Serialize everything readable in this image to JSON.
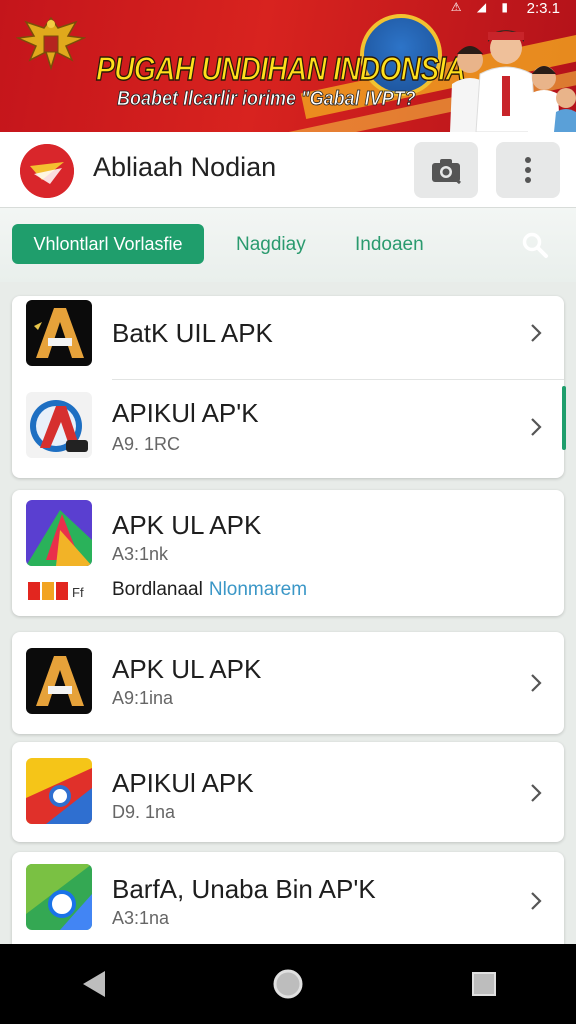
{
  "status_bar": {
    "time": "2:3.1",
    "icons": "⚠ ◢ ▮"
  },
  "banner": {
    "title": "PUGAH UNDIHAN INDONSIA",
    "subtitle": "Boabet Ilcarlir iorime \"Gabal IVPT?"
  },
  "header": {
    "title": "Abliaah Nodian",
    "camera_icon": "camera-icon",
    "more_icon": "more-vert-icon"
  },
  "tabs": [
    {
      "label": "Vhlontlarl Vorlasfie",
      "active": true
    },
    {
      "label": "Nagdiay",
      "active": false
    },
    {
      "label": "Indoaen",
      "active": false
    }
  ],
  "cards": [
    {
      "rows": [
        {
          "title": "BatK UIL APK",
          "sub": ""
        },
        {
          "title": "APIKUl AP'K",
          "sub": "A9. 1RC"
        }
      ]
    },
    {
      "rows": [
        {
          "title": "APK UL APK",
          "sub": "A3:1nk"
        }
      ],
      "extra": {
        "label": "Bordlanaal",
        "link": "Nlonmarem",
        "tag_text": "IDIDF"
      }
    },
    {
      "rows": [
        {
          "title": "APK UL APK",
          "sub": "A9:1ina"
        }
      ]
    },
    {
      "rows": [
        {
          "title": "APIKUl APK",
          "sub": "D9. 1na"
        }
      ]
    },
    {
      "rows": [
        {
          "title": "BarfA, Unaba Bin AP'K",
          "sub": "A3:1na"
        }
      ]
    }
  ],
  "colors": {
    "accent": "#1f9e6c",
    "banner_red": "#d8231f",
    "banner_yellow": "#ffe01c",
    "link": "#3b97c7"
  },
  "navbar": {
    "back_icon": "back-triangle-icon",
    "home_icon": "home-circle-icon",
    "recent_icon": "recent-square-icon"
  }
}
